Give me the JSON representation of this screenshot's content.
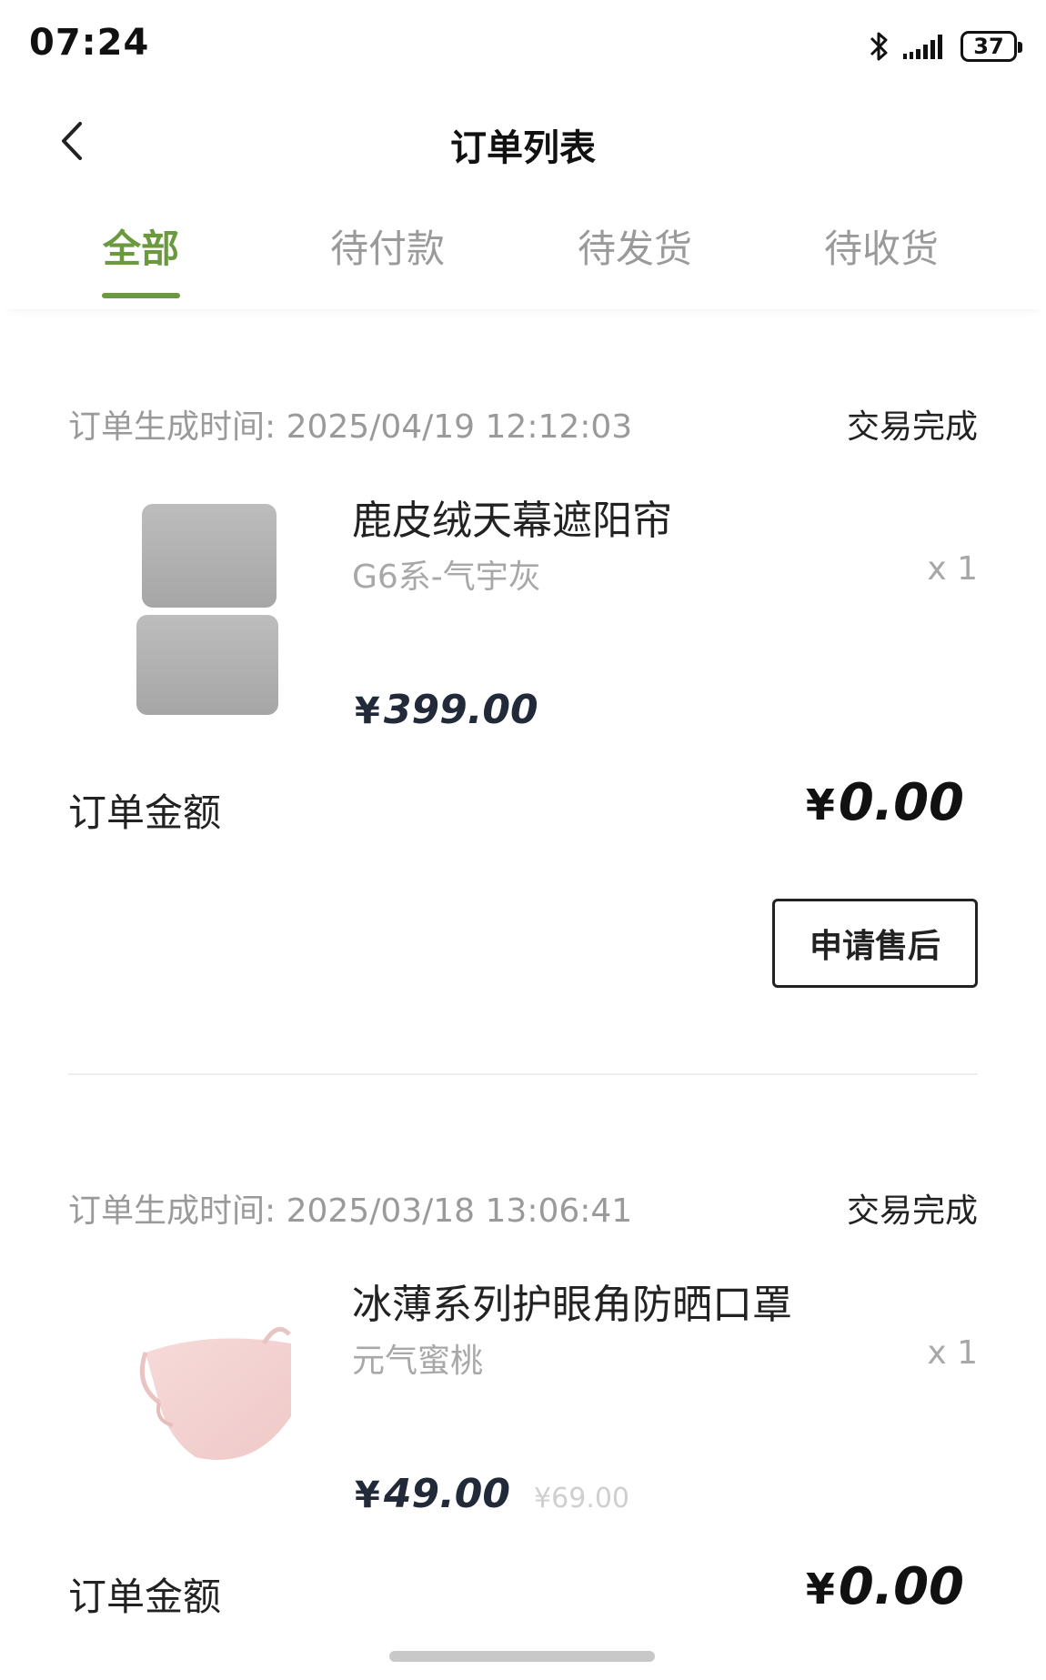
{
  "status_bar": {
    "time": "07:24",
    "battery": "37"
  },
  "header": {
    "title": "订单列表"
  },
  "tabs": [
    {
      "label": "全部",
      "active": true
    },
    {
      "label": "待付款",
      "active": false
    },
    {
      "label": "待发货",
      "active": false
    },
    {
      "label": "待收货",
      "active": false
    }
  ],
  "orders": [
    {
      "time_label": "订单生成时间: 2025/04/19 12:12:03",
      "status": "交易完成",
      "product_name": "鹿皮绒天幕遮阳帘",
      "variant": "G6系-气宇灰",
      "qty": "x 1",
      "currency": "¥",
      "price": "399.00",
      "original_price": "",
      "total_label": "订单金额",
      "total_value": "0.00",
      "button_label": "申请售后"
    },
    {
      "time_label": "订单生成时间: 2025/03/18 13:06:41",
      "status": "交易完成",
      "product_name": "冰薄系列护眼角防晒口罩",
      "variant": "元气蜜桃",
      "qty": "x 1",
      "currency": "¥",
      "price": "49.00",
      "original_price": "¥69.00",
      "total_label": "订单金额",
      "total_value": "0.00"
    }
  ],
  "colors": {
    "accent": "#6b9a3e",
    "muted": "#9a9a9a"
  },
  "icons": [
    "bluetooth-icon",
    "signal-icon",
    "battery-icon",
    "back-arrow-icon"
  ]
}
